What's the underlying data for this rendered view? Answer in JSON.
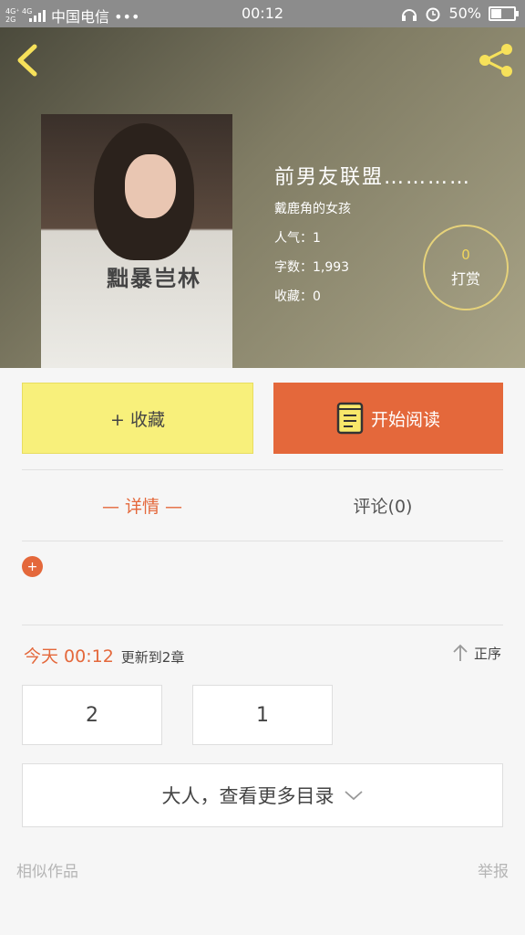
{
  "status_bar": {
    "network": "4G⁺ 4G\n2G",
    "carrier": "中国电信 •••",
    "time": "00:12",
    "battery": "50%",
    "battery_level": 0.5
  },
  "book": {
    "title": "前男友联盟…………",
    "author": "戴鹿角的女孩",
    "popularity": "人气：1",
    "word_count": "字数：1,993",
    "favorites": "收藏：0",
    "cover_shirt_text": "黜暴岂林"
  },
  "tip": {
    "count": "0",
    "label": "打赏"
  },
  "actions": {
    "collect_label": "+ 收藏",
    "read_label": "开始阅读"
  },
  "tabs": {
    "detail": "— 详情 —",
    "comment": "评论(0)"
  },
  "expand_icon": "+",
  "update": {
    "time": "今天 00:12",
    "text": "更新到2章"
  },
  "sort_label": "正序",
  "chapters": [
    "2",
    "1"
  ],
  "more_catalog_label": "大人，查看更多目录",
  "footer": {
    "similar": "相似作品",
    "report": "举报"
  },
  "colors": {
    "accent": "#e4683b",
    "collect_bg": "#f8f07b",
    "tip_ring": "#e6d27a"
  }
}
